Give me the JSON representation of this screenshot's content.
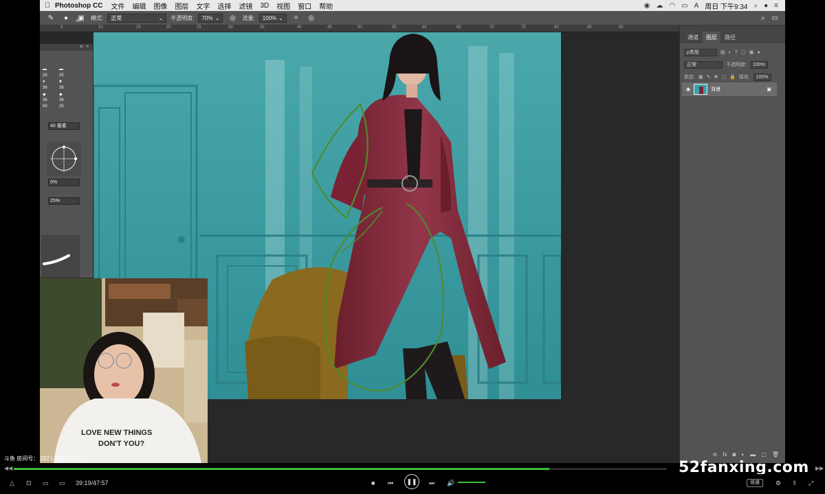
{
  "menubar": {
    "apple_icon": "apple-icon",
    "app_name": "Photoshop CC",
    "items": [
      "文件",
      "编辑",
      "图像",
      "图层",
      "文字",
      "选择",
      "滤镜",
      "3D",
      "视图",
      "窗口",
      "帮助"
    ],
    "clock": "周日 下午9:34"
  },
  "options": {
    "mode_label": "模式:",
    "mode_value": "正常",
    "opacity_label": "不透明度:",
    "opacity_value": "70%",
    "flow_label": "流量:",
    "flow_value": "100%",
    "brush_size": "40"
  },
  "ruler": {
    "ticks": [
      "5",
      "10",
      "15",
      "20",
      "25",
      "30",
      "35",
      "40",
      "45",
      "50",
      "55",
      "60",
      "65",
      "70",
      "75",
      "80",
      "85",
      "90"
    ]
  },
  "brush_panel": {
    "sizes": [
      "25",
      "25",
      "36",
      "36",
      "36",
      "36",
      "50",
      "25"
    ],
    "size_field": "40 像素",
    "angle_field": "0%",
    "roundness_field": "25%"
  },
  "layers_panel": {
    "tabs": [
      "通道",
      "图层",
      "路径"
    ],
    "kind_label": "ρ类型",
    "blend": "正常",
    "opacity_label": "不透明度:",
    "opacity_value": "100%",
    "lock_label": "锁定:",
    "fill_label": "填充:",
    "fill_value": "100%",
    "layer_name": "背景"
  },
  "stream": {
    "info": "斗鱼 房间号：    152 | 2019.01.06",
    "time": "39:19/47:57",
    "speed_label": "倍速",
    "watermark": "52fanxing.com",
    "progress": 0.82
  },
  "colors": {
    "teal_wall": "#3fa5a9",
    "coat": "#7c2634",
    "chair": "#8a6a1f",
    "green_stroke": "#4f8a2e",
    "progress": "#3bbf3a"
  }
}
